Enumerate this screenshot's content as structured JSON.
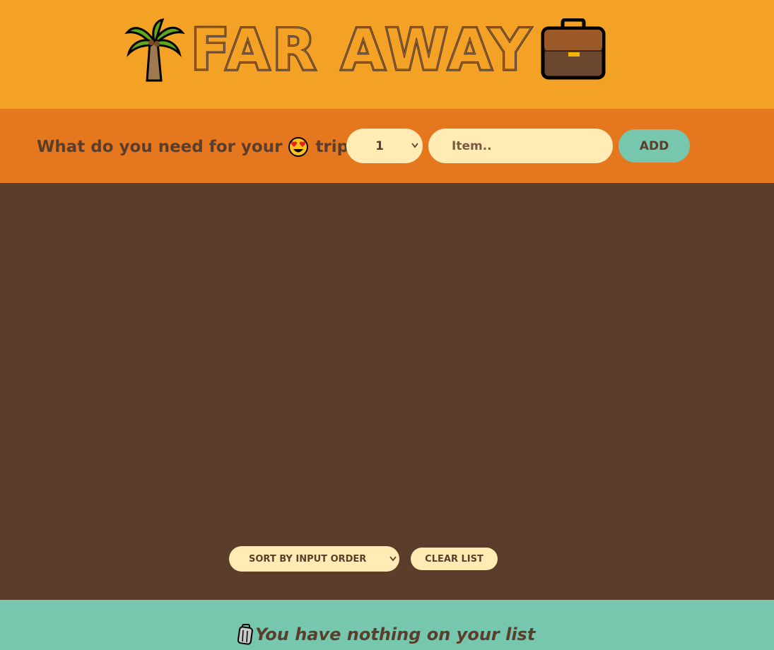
{
  "header": {
    "title": "FAR AWAY",
    "left_icon": "palm-tree-icon",
    "right_icon": "briefcase-icon"
  },
  "form": {
    "question_before": "What do you need for your",
    "question_icon": "heart-eyes-face-icon",
    "question_after": "trip?",
    "quantity_value": "1",
    "item_placeholder": "Item..",
    "add_label": "ADD"
  },
  "actions": {
    "sort_value": "SORT BY INPUT ORDER",
    "clear_label": "CLEAR LIST"
  },
  "stats": {
    "icon": "luggage-icon",
    "message": "You have nothing on your list"
  },
  "colors": {
    "header_bg": "#f4a226",
    "form_bg": "#e5771e",
    "list_bg": "#5a3e2b",
    "stats_bg": "#76c7ad",
    "input_bg": "#ffebb3",
    "text_dark": "#5a3e2b"
  }
}
